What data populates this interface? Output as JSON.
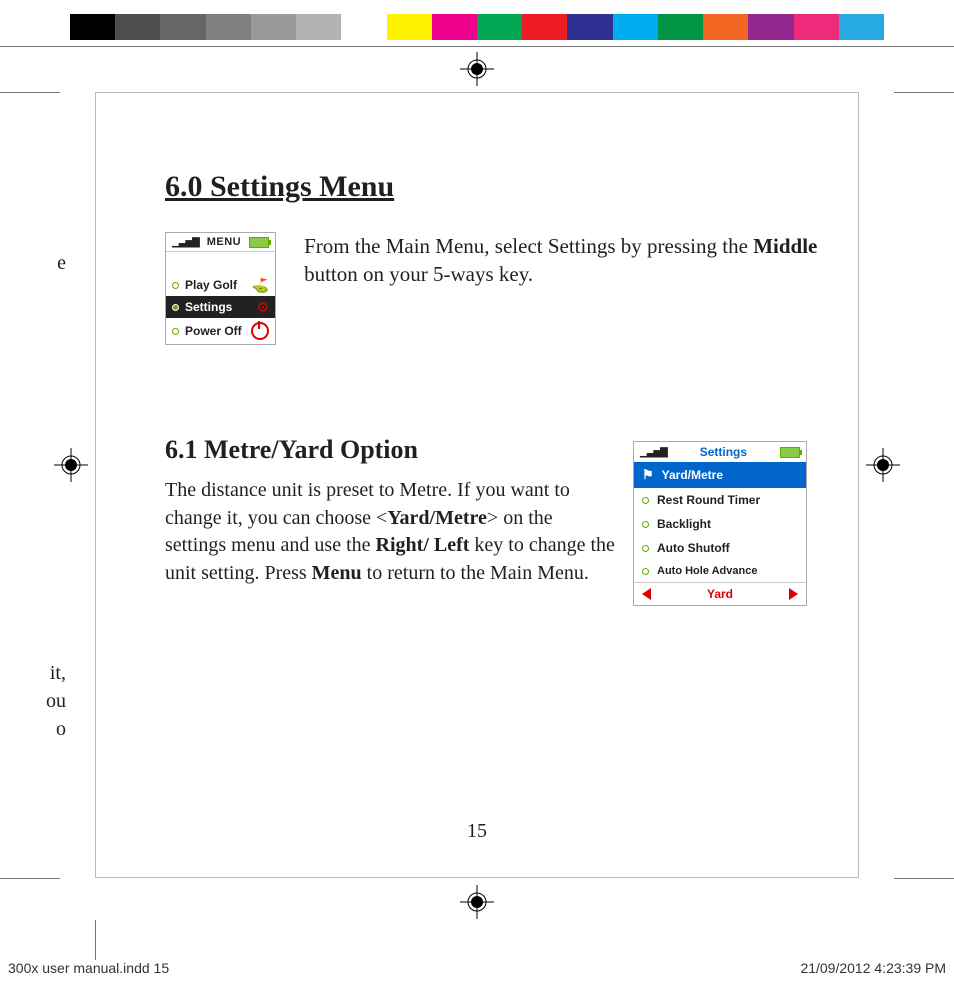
{
  "heading": "6.0 Settings Menu",
  "intro_parts": {
    "p1": "From the Main Menu, select Settings  by pressing the ",
    "bold1": "Middle",
    "p2": " button on your 5-ways key."
  },
  "sub_heading": "6.1 Metre/Yard Option",
  "para_parts": {
    "p1": "The distance unit is preset to Metre. If you want to change it, you can choose <",
    "b1": "Yard/Metre",
    "p2": "> on the settings menu and use the ",
    "b2": "Right/ Left",
    "p3": " key to change the unit setting. Press ",
    "b3": "Menu",
    "p4": " to return to the Main Menu."
  },
  "screen1": {
    "title": "MENU",
    "items": [
      "Play Golf",
      "Settings",
      "Power Off"
    ]
  },
  "screen2": {
    "title": "Settings",
    "items": [
      "Yard/Metre",
      "Rest Round Timer",
      "Backlight",
      "Auto Shutoff",
      "Auto Hole Advance"
    ],
    "footer": "Yard"
  },
  "page_num": "15",
  "slug": "300x user manual.indd   15",
  "datestamp": "21/09/2012   4:23:39 PM",
  "color_bar": [
    "#000000",
    "#4d4d4d",
    "#666666",
    "#808080",
    "#999999",
    "#b3b3b3",
    "#ffffff",
    "#fff200",
    "#ec008c",
    "#00a651",
    "#ed1c24",
    "#2e3192",
    "#00aeef",
    "#009444",
    "#f26522",
    "#92278f",
    "#ee2a7b",
    "#27aae1"
  ],
  "bleed": {
    "l1": "e",
    "l2": "it,",
    "l3": "ou",
    "l4": "o"
  }
}
